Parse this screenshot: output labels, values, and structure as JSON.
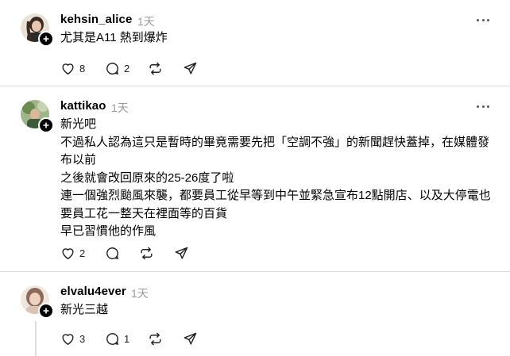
{
  "posts": [
    {
      "username": "kehsin_alice",
      "time": "1天",
      "lines": [
        "尤其是A11 熱到爆炸"
      ],
      "likes": "8",
      "replies": "2",
      "avatar_icon": "user-avatar-photo"
    },
    {
      "username": "kattikao",
      "time": "1天",
      "lines": [
        "新光吧",
        "不過私人認為這只是暫時的畢竟需要先把「空調不強」的新聞趕快蓋掉，在媒體發",
        "布以前",
        "之後就會改回原來的25-26度了啦",
        "連一個強烈颱風來襲，都要員工從早等到中午並緊急宣布12點開店、以及大停電也",
        "要員工花一整天在裡面等的百貨",
        "早已習慣他的作風"
      ],
      "likes": "2",
      "replies": "",
      "avatar_icon": "user-avatar-photo"
    },
    {
      "username": "elvalu4ever",
      "time": "1天",
      "lines": [
        "新光三越"
      ],
      "likes": "3",
      "replies": "1",
      "avatar_icon": "user-avatar-photo"
    }
  ],
  "icons": {
    "like": "heart-icon",
    "reply": "comment-icon",
    "repost": "repost-icon",
    "share": "send-icon",
    "more": "more-icon",
    "follow": "plus-icon"
  },
  "colors": {
    "text": "#000000",
    "muted": "#9a9a9a",
    "divider": "#dcdcdc"
  }
}
